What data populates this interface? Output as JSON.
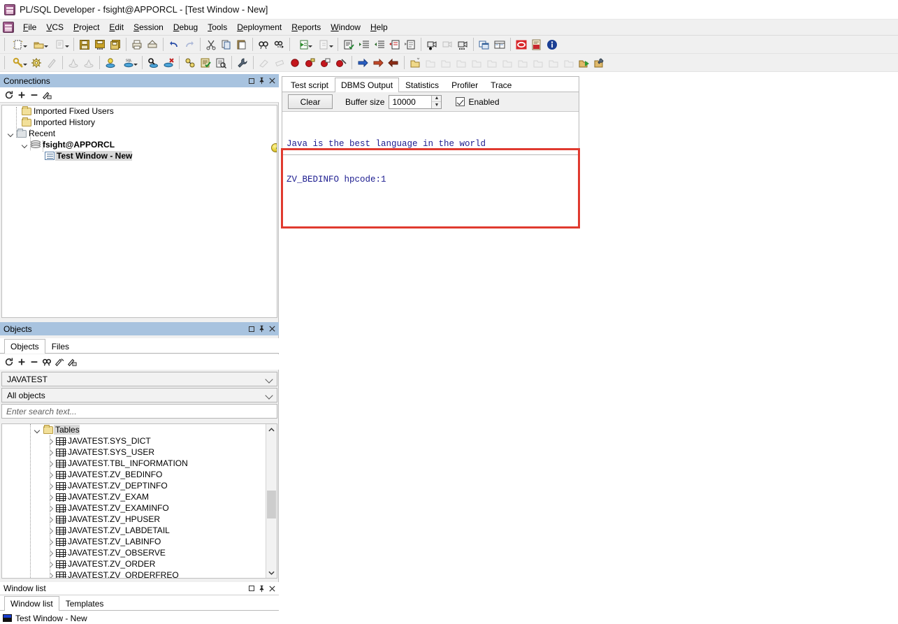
{
  "window": {
    "title": "PL/SQL Developer - fsight@APPORCL - [Test Window - New]",
    "app_icon": "plsql-developer-icon"
  },
  "menubar": {
    "items": [
      {
        "label": "File",
        "mnemonic": "F"
      },
      {
        "label": "VCS",
        "mnemonic": "V"
      },
      {
        "label": "Project",
        "mnemonic": "P"
      },
      {
        "label": "Edit",
        "mnemonic": "E"
      },
      {
        "label": "Session",
        "mnemonic": "S"
      },
      {
        "label": "Debug",
        "mnemonic": "D"
      },
      {
        "label": "Tools",
        "mnemonic": "T"
      },
      {
        "label": "Deployment",
        "mnemonic": "D"
      },
      {
        "label": "Reports",
        "mnemonic": "R"
      },
      {
        "label": "Window",
        "mnemonic": "W"
      },
      {
        "label": "Help",
        "mnemonic": "H"
      }
    ]
  },
  "connections_pane": {
    "title": "Connections",
    "tree": [
      {
        "label": "Imported Fixed Users",
        "icon": "folder-icon",
        "indent": 1,
        "expander": "none",
        "bold": false,
        "selected": false
      },
      {
        "label": "Imported History",
        "icon": "folder-icon",
        "indent": 1,
        "expander": "none",
        "bold": false,
        "selected": false
      },
      {
        "label": "Recent",
        "icon": "folder-grey-icon",
        "indent": 0,
        "expander": "down",
        "bold": false,
        "selected": false
      },
      {
        "label": "fsight@APPORCL",
        "icon": "database-icon",
        "indent": 1,
        "expander": "down",
        "bold": true,
        "selected": false
      },
      {
        "label": "Test Window - New",
        "icon": "window-icon",
        "indent": 2,
        "expander": "none",
        "bold": true,
        "selected": true
      }
    ],
    "badge_icon": "key-ball-icon"
  },
  "objects_pane": {
    "title": "Objects",
    "tabs": [
      {
        "label": "Objects",
        "active": true
      },
      {
        "label": "Files",
        "active": false
      }
    ],
    "schema_combo": "JAVATEST",
    "filter_combo": "All objects",
    "search_placeholder": "Enter search text...",
    "root": {
      "label": "Tables",
      "icon": "folder-open-icon"
    },
    "tables": [
      "JAVATEST.SYS_DICT",
      "JAVATEST.SYS_USER",
      "JAVATEST.TBL_INFORMATION",
      "JAVATEST.ZV_BEDINFO",
      "JAVATEST.ZV_DEPTINFO",
      "JAVATEST.ZV_EXAM",
      "JAVATEST.ZV_EXAMINFO",
      "JAVATEST.ZV_HPUSER",
      "JAVATEST.ZV_LABDETAIL",
      "JAVATEST.ZV_LABINFO",
      "JAVATEST.ZV_OBSERVE",
      "JAVATEST.ZV_ORDER",
      "JAVATEST.ZV_ORDERFREQ"
    ]
  },
  "window_list_pane": {
    "title": "Window list",
    "tabs": [
      {
        "label": "Window list",
        "active": true
      },
      {
        "label": "Templates",
        "active": false
      }
    ],
    "items": [
      "Test Window - New"
    ]
  },
  "editor": {
    "tabs": [
      {
        "label": "Test script",
        "active": false
      },
      {
        "label": "DBMS Output",
        "active": true
      },
      {
        "label": "Statistics",
        "active": false
      },
      {
        "label": "Profiler",
        "active": false
      },
      {
        "label": "Trace",
        "active": false
      }
    ],
    "toolbar": {
      "clear_label": "Clear",
      "buffer_size_label": "Buffer size",
      "buffer_size_value": "10000",
      "enabled_label": "Enabled",
      "enabled_checked": true
    },
    "output_lines": [
      "Java is the best language in the world",
      "ZV_BEDINFO hpcode:1"
    ]
  },
  "colors": {
    "pane_title_bg": "#a8c3df",
    "output_text": "#1b1b8f",
    "highlight_border": "#e03a2f",
    "toolbar_bg": "#f0f0f0"
  },
  "pane_buttons": {
    "maximize": "maximize-icon",
    "pin": "pin-icon",
    "close": "close-icon"
  }
}
